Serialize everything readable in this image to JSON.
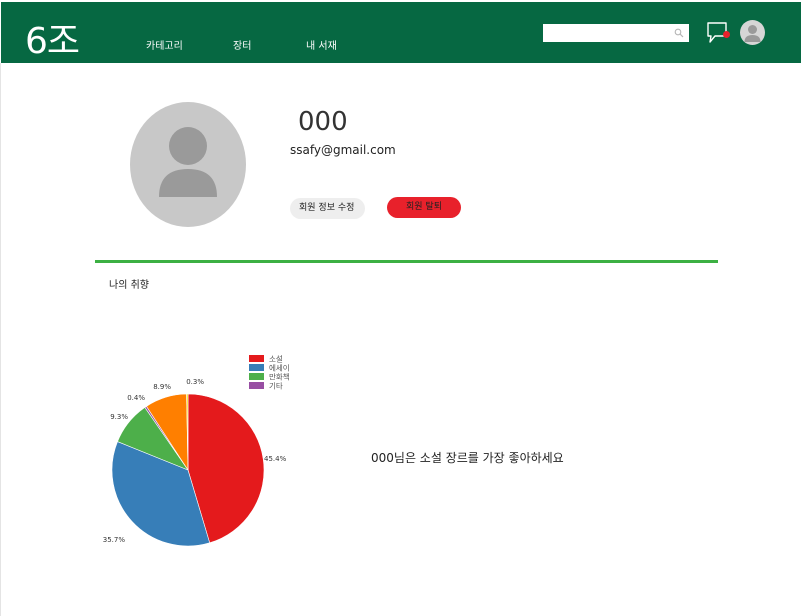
{
  "header": {
    "logo": "6조",
    "nav": [
      {
        "label": "카테고리"
      },
      {
        "label": "장터"
      },
      {
        "label": "내 서재"
      }
    ],
    "search": {
      "placeholder": "",
      "value": ""
    },
    "icons": {
      "search": "search-icon",
      "chat": "chat-icon",
      "avatar": "user-avatar-icon"
    },
    "colors": {
      "bar": "#066842",
      "notification": "#e8212b"
    }
  },
  "profile": {
    "name": "000",
    "email": "ssafy@gmail.com",
    "edit_button": "회원 정보 수정",
    "withdraw_button": "회원 탈퇴"
  },
  "taste": {
    "title": "나의 취향",
    "summary": "000님은 소설 장르를 가장 좋아하세요"
  },
  "chart_data": {
    "type": "pie",
    "slices": [
      {
        "label": "소설",
        "value": 45.4,
        "value_label": "45.4%",
        "color": "#e41a1c"
      },
      {
        "label": "에세이",
        "value": 35.7,
        "value_label": "35.7%",
        "color": "#377eb8"
      },
      {
        "label": "만화책",
        "value": 9.3,
        "value_label": "9.3%",
        "color": "#4daf4a"
      },
      {
        "label": "기타",
        "value": 0.4,
        "value_label": "0.4%",
        "color": "#984ea3"
      },
      {
        "label": "",
        "value": 8.9,
        "value_label": "8.9%",
        "color": "#ff7f00"
      },
      {
        "label": "",
        "value": 0.3,
        "value_label": "0.3%",
        "color": "#f2e600"
      }
    ],
    "legend": [
      "소설",
      "에세이",
      "만화책",
      "기타"
    ],
    "legend_position": "top-right"
  }
}
